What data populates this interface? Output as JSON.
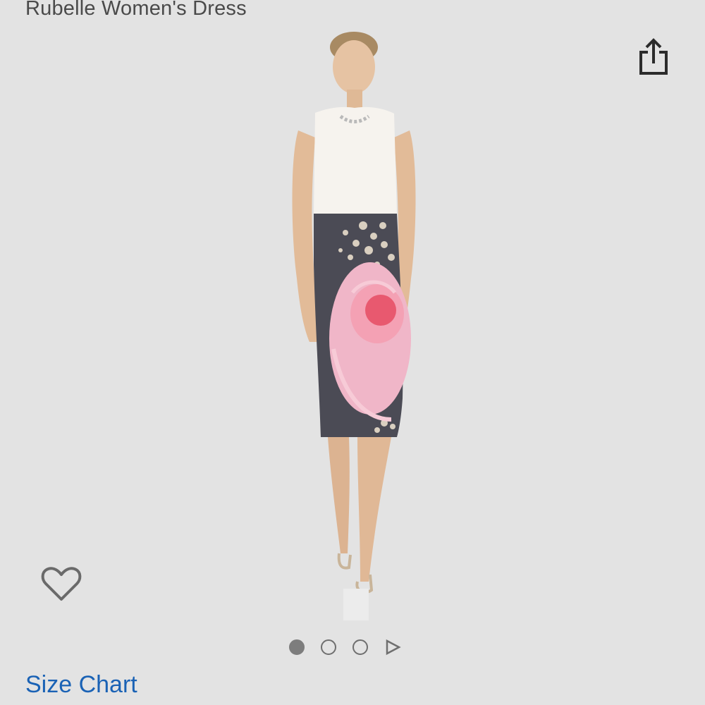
{
  "product": {
    "title": "Rubelle Women's Dress"
  },
  "actions": {
    "share_icon": "share-icon",
    "wishlist_icon": "heart-outline-icon"
  },
  "carousel": {
    "total_images": 3,
    "active_index": 0,
    "has_video": true
  },
  "links": {
    "size_chart": "Size Chart"
  },
  "colors": {
    "background": "#e3e3e3",
    "title_text": "#4a4a4a",
    "link_blue": "#1a62b5",
    "icon_gray": "#6f6f6f"
  }
}
